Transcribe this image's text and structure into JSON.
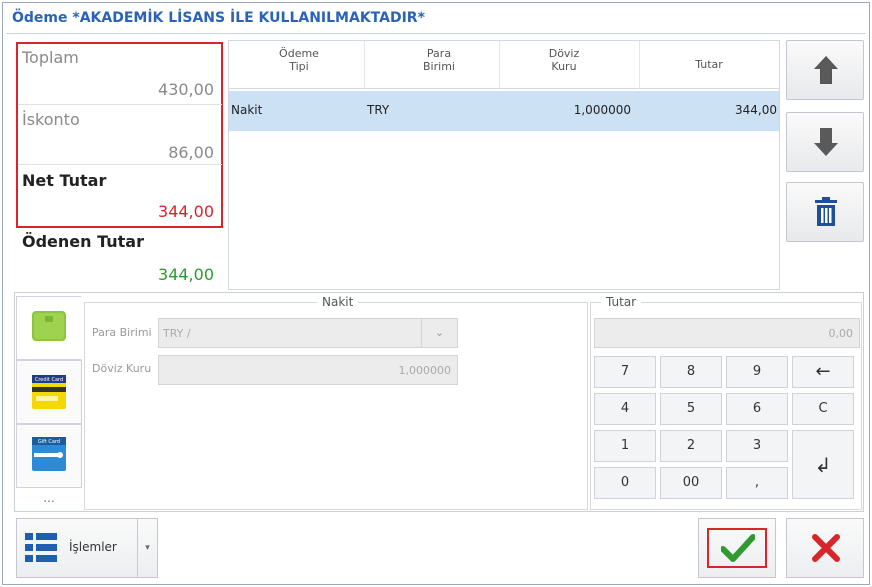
{
  "window": {
    "title": "Ödeme *AKADEMİK LİSANS İLE KULLANILMAKTADIR*"
  },
  "totals": {
    "toplam_label": "Toplam",
    "toplam_value": "430,00",
    "iskonto_label": "İskonto",
    "iskonto_value": "86,00",
    "net_label": "Net Tutar",
    "net_value": "344,00",
    "odenen_label": "Ödenen Tutar",
    "odenen_value": "344,00"
  },
  "grid": {
    "columns": [
      "Ödeme\nTipi",
      "Para\nBirimi",
      "Döviz\nKuru",
      "Tutar"
    ],
    "rows": [
      {
        "odeme_tipi": "Nakit",
        "para_birimi": "TRY",
        "doviz_kuru": "1,000000",
        "tutar": "344,00"
      }
    ]
  },
  "side_buttons": {
    "up_icon": "arrow-up-icon",
    "down_icon": "arrow-down-icon",
    "delete_icon": "trash-icon"
  },
  "payment_types": [
    {
      "name": "cash",
      "icon": "cash-icon",
      "active": true
    },
    {
      "name": "credit-card",
      "icon": "credit-card-icon",
      "label": "Credit Card"
    },
    {
      "name": "gift-card",
      "icon": "gift-card-icon",
      "label": "Gift Card"
    }
  ],
  "payment_types_more": "...",
  "nakit_panel": {
    "legend": "Nakit",
    "para_birimi_label": "Para Birimi",
    "para_birimi_value": "TRY /",
    "doviz_kuru_label": "Döviz Kuru",
    "doviz_kuru_value": "1,000000"
  },
  "tutar_panel": {
    "legend": "Tutar",
    "display": "0,00",
    "keys": [
      "7",
      "8",
      "9",
      "←",
      "4",
      "5",
      "6",
      "C",
      "1",
      "2",
      "3",
      "↲",
      "0",
      "00",
      ","
    ]
  },
  "bottom": {
    "islemler_label": "İşlemler",
    "islemler_dropdown": "▾"
  },
  "colors": {
    "accent": "#2a63b5",
    "red": "#d7262b",
    "green": "#2f9a2f",
    "selected_row": "#cde1f5"
  }
}
